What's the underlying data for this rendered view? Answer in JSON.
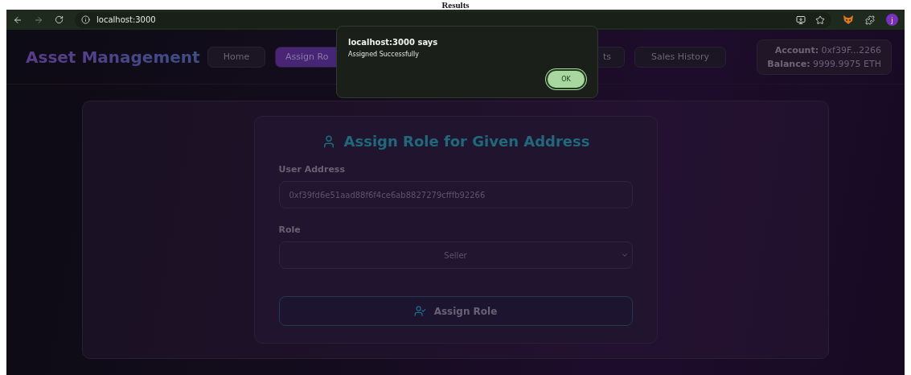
{
  "caption": "Results",
  "browser": {
    "url": "localhost:3000",
    "profile_initial": "j"
  },
  "header": {
    "brand": "Asset Management",
    "nav": [
      {
        "label": "Home",
        "selected": false
      },
      {
        "label": "Assign Ro",
        "selected": true
      },
      {
        "label": "ts",
        "selected": false
      },
      {
        "label": "Sales History",
        "selected": false
      }
    ],
    "account": {
      "account_label": "Account:",
      "account_value": "0xf39F...2266",
      "balance_label": "Balance:",
      "balance_value": "9999.9975 ETH"
    }
  },
  "form": {
    "title": "Assign Role for Given Address",
    "fields": [
      {
        "label": "User Address",
        "kind": "input",
        "value": "0xf39fd6e51aad88f6f4ce6ab8827279cfffb92266"
      },
      {
        "label": "Role",
        "kind": "select",
        "value": "Seller"
      }
    ],
    "submit": "Assign Role"
  },
  "dialog": {
    "title": "localhost:3000 says",
    "message": "Assigned Successfully",
    "button": "OK"
  }
}
